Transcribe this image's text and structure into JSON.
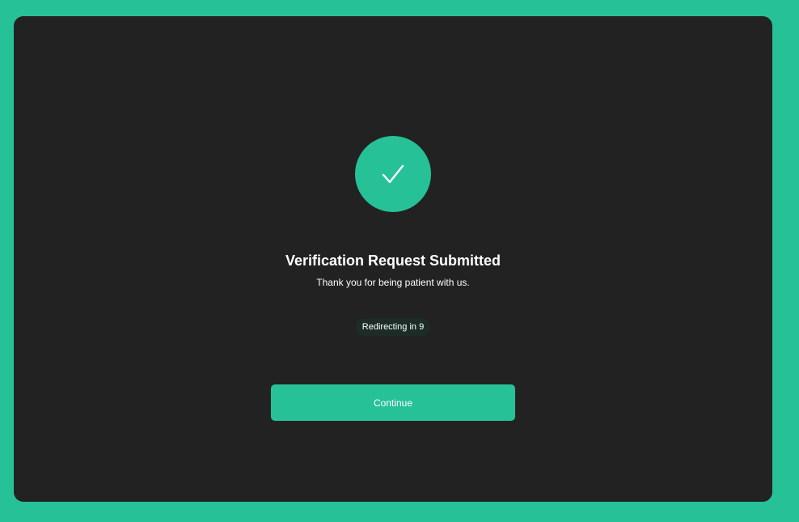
{
  "colors": {
    "page_background": "#27c198",
    "card_background": "#222222",
    "accent": "#27c198",
    "badge_background": "#1d2c27",
    "text": "#ffffff"
  },
  "status": {
    "icon": "checkmark-icon",
    "title": "Verification Request Submitted",
    "message": "Thank you for being patient with us."
  },
  "redirect": {
    "label": "Redirecting in 9"
  },
  "actions": {
    "continue_label": "Continue"
  }
}
